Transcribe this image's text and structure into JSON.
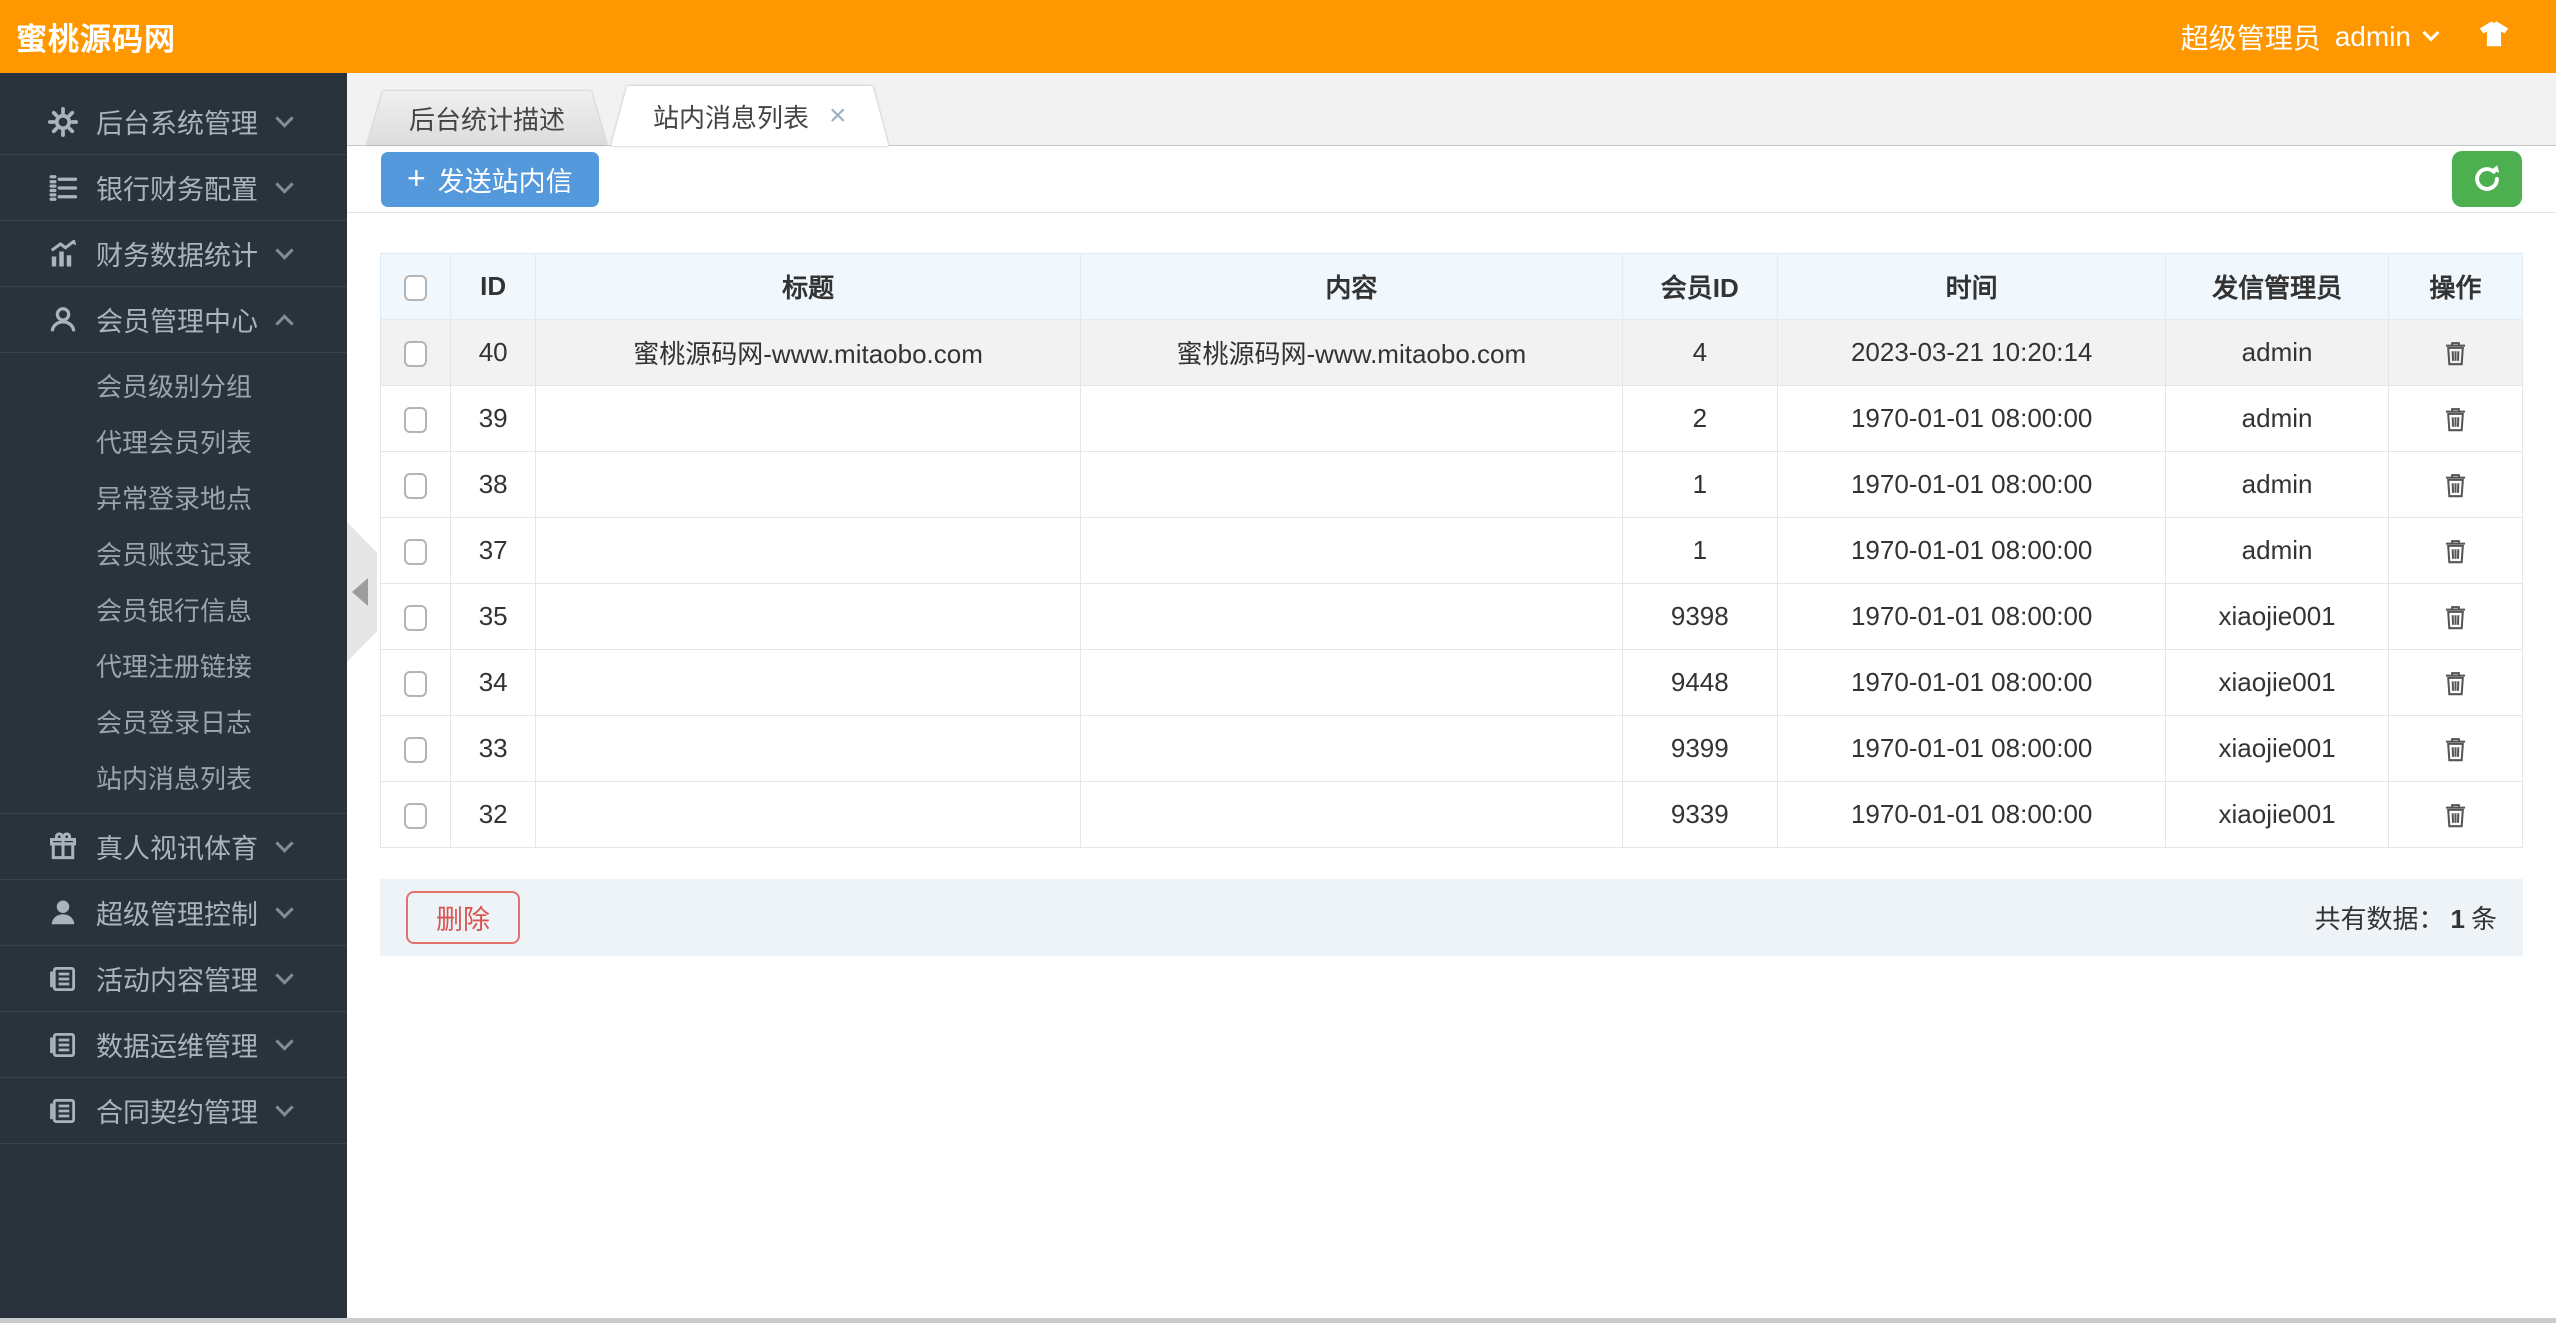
{
  "topbar": {
    "logo": "蜜桃源码网",
    "role": "超级管理员",
    "username": "admin",
    "icon": "tshirt"
  },
  "sidebar": {
    "items": [
      {
        "label": "后台系统管理",
        "icon": "gear",
        "expanded": false
      },
      {
        "label": "银行财务配置",
        "icon": "listnum",
        "expanded": false
      },
      {
        "label": "财务数据统计",
        "icon": "chart",
        "expanded": false
      },
      {
        "label": "会员管理中心",
        "icon": "user",
        "expanded": true,
        "children": [
          "会员级别分组",
          "代理会员列表",
          "异常登录地点",
          "会员账变记录",
          "会员银行信息",
          "代理注册链接",
          "会员登录日志",
          "站内消息列表"
        ]
      },
      {
        "label": "真人视讯体育",
        "icon": "gift",
        "expanded": false
      },
      {
        "label": "超级管理控制",
        "icon": "usersolid",
        "expanded": false
      },
      {
        "label": "活动内容管理",
        "icon": "news",
        "expanded": false
      },
      {
        "label": "数据运维管理",
        "icon": "news",
        "expanded": false
      },
      {
        "label": "合同契约管理",
        "icon": "news",
        "expanded": false
      }
    ]
  },
  "tabs": [
    {
      "label": "后台统计描述",
      "active": false
    },
    {
      "label": "站内消息列表",
      "active": true,
      "close_glyph": "×"
    }
  ],
  "toolbar": {
    "plus_glyph": "+",
    "send_label": "发送站内信",
    "refresh_icon": "refresh"
  },
  "table": {
    "headers": {
      "id": "ID",
      "title": "标题",
      "content": "内容",
      "member_id": "会员ID",
      "time": "时间",
      "sender": "发信管理员",
      "op": "操作"
    },
    "op_icon": "trash",
    "rows": [
      {
        "id": "40",
        "title": "蜜桃源码网-www.mitaobo.com",
        "content": "蜜桃源码网-www.mitaobo.com",
        "member_id": "4",
        "time": "2023-03-21 10:20:14",
        "sender": "admin"
      },
      {
        "id": "39",
        "title": "",
        "content": "",
        "member_id": "2",
        "time": "1970-01-01 08:00:00",
        "sender": "admin"
      },
      {
        "id": "38",
        "title": "",
        "content": "",
        "member_id": "1",
        "time": "1970-01-01 08:00:00",
        "sender": "admin"
      },
      {
        "id": "37",
        "title": "",
        "content": "",
        "member_id": "1",
        "time": "1970-01-01 08:00:00",
        "sender": "admin"
      },
      {
        "id": "35",
        "title": "",
        "content": "",
        "member_id": "9398",
        "time": "1970-01-01 08:00:00",
        "sender": "xiaojie001"
      },
      {
        "id": "34",
        "title": "",
        "content": "",
        "member_id": "9448",
        "time": "1970-01-01 08:00:00",
        "sender": "xiaojie001"
      },
      {
        "id": "33",
        "title": "",
        "content": "",
        "member_id": "9399",
        "time": "1970-01-01 08:00:00",
        "sender": "xiaojie001"
      },
      {
        "id": "32",
        "title": "",
        "content": "",
        "member_id": "9339",
        "time": "1970-01-01 08:00:00",
        "sender": "xiaojie001"
      }
    ]
  },
  "footer": {
    "delete_label": "删除",
    "total_prefix": "共有数据：",
    "total_value": "1",
    "total_suffix": "条"
  },
  "colors": {
    "topbar_orange": "#FF9800",
    "sidebar_dark": "#2a333b",
    "button_blue": "#5499DB",
    "button_green": "#4CAF50",
    "delete_red": "#d9534f",
    "header_blue_bg": "#f1f8fd",
    "footer_bar_bg": "#eef3f8",
    "shaded_row_bg": "#f2f2f2"
  }
}
